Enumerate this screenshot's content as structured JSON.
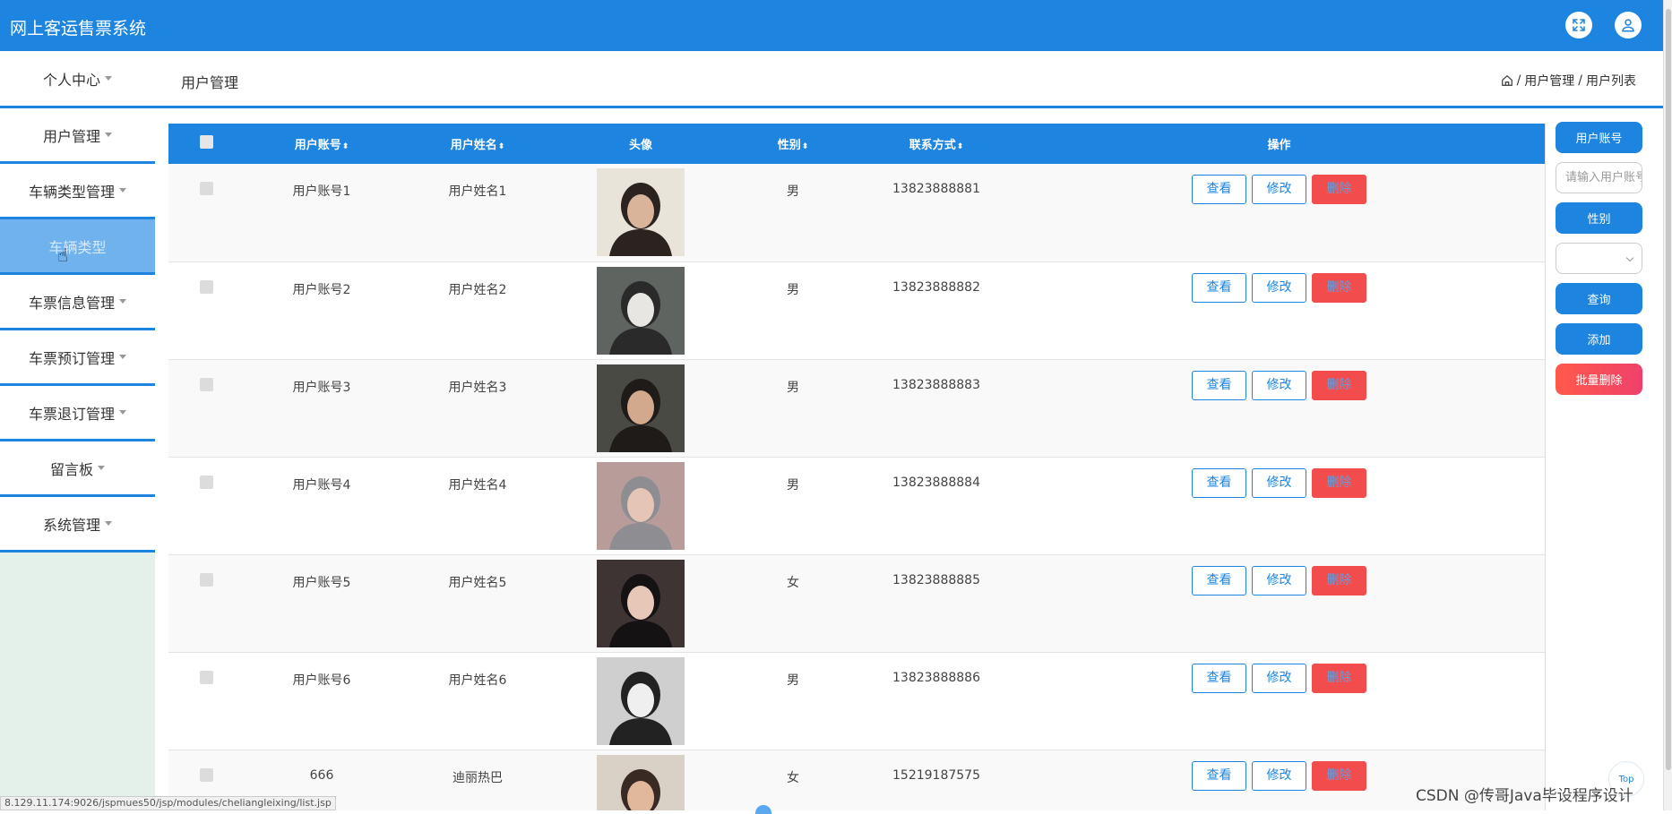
{
  "app": {
    "title": "网上客运售票系统"
  },
  "topbar": {
    "icons": [
      "fullscreen-icon",
      "user-icon"
    ]
  },
  "header": {
    "menu_center": "个人中心",
    "page_title": "用户管理",
    "breadcrumb": {
      "level1": "用户管理",
      "sep": "/",
      "level2": "用户列表"
    }
  },
  "sidebar": {
    "items": [
      {
        "label": "用户管理"
      },
      {
        "label": "车辆类型管理"
      },
      {
        "label": "车辆类型"
      },
      {
        "label": "车票信息管理"
      },
      {
        "label": "车票预订管理"
      },
      {
        "label": "车票退订管理"
      },
      {
        "label": "留言板"
      },
      {
        "label": "系统管理"
      }
    ]
  },
  "table": {
    "headers": {
      "account": "用户账号",
      "name": "用户姓名",
      "avatar": "头像",
      "gender": "性别",
      "phone": "联系方式",
      "ops": "操作"
    },
    "rows": [
      {
        "account": "用户账号1",
        "name": "用户姓名1",
        "gender": "男",
        "phone": "13823888881"
      },
      {
        "account": "用户账号2",
        "name": "用户姓名2",
        "gender": "男",
        "phone": "13823888882"
      },
      {
        "account": "用户账号3",
        "name": "用户姓名3",
        "gender": "男",
        "phone": "13823888883"
      },
      {
        "account": "用户账号4",
        "name": "用户姓名4",
        "gender": "男",
        "phone": "13823888884"
      },
      {
        "account": "用户账号5",
        "name": "用户姓名5",
        "gender": "女",
        "phone": "13823888885"
      },
      {
        "account": "用户账号6",
        "name": "用户姓名6",
        "gender": "男",
        "phone": "13823888886"
      },
      {
        "account": "666",
        "name": "迪丽热巴",
        "gender": "女",
        "phone": "15219187575"
      }
    ],
    "ops": {
      "view": "查看",
      "edit": "修改",
      "delete": "删除"
    }
  },
  "search": {
    "account_label": "用户账号",
    "account_placeholder": "请输入用户账号",
    "gender_label": "性别",
    "gender_value": "",
    "query": "查询",
    "add": "添加",
    "batch_delete": "批量删除"
  },
  "status_url": "8.129.11.174:9026/jspmues50/jsp/modules/cheliangleixing/list.jsp",
  "watermark": "CSDN @传哥Java毕设程序设计",
  "top_button": "Top",
  "colors": {
    "primary": "#1d84df",
    "danger": "#f34c4c",
    "sidebar_bg": "#e3f1ea"
  }
}
